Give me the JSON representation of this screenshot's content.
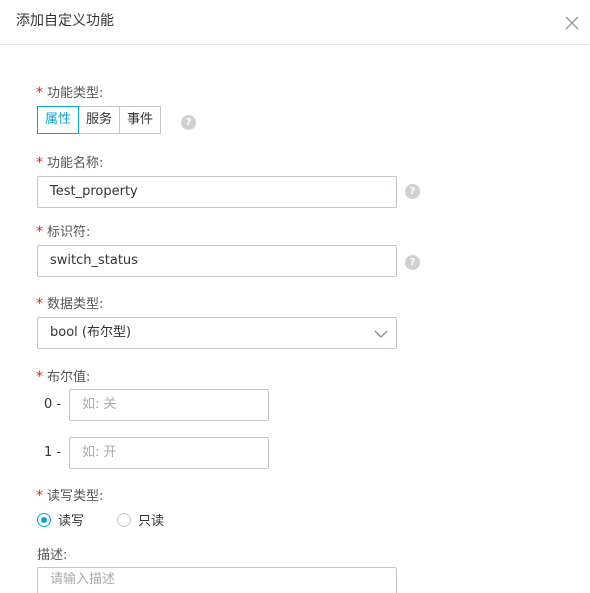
{
  "dialog": {
    "title": "添加自定义功能"
  },
  "fields": {
    "function_type": {
      "label": "功能类型:",
      "options": [
        "属性",
        "服务",
        "事件"
      ],
      "selected": "属性"
    },
    "function_name": {
      "label": "功能名称:",
      "value": "Test_property"
    },
    "identifier": {
      "label": "标识符:",
      "value": "switch_status"
    },
    "data_type": {
      "label": "数据类型:",
      "value": "bool (布尔型)"
    },
    "bool_value": {
      "label": "布尔值:",
      "zero_prefix": "0 -",
      "zero_placeholder": "如: 关",
      "one_prefix": "1 -",
      "one_placeholder": "如: 开"
    },
    "rw_type": {
      "label": "读写类型:",
      "options": [
        "读写",
        "只读"
      ],
      "selected": "读写"
    },
    "description": {
      "label": "描述:",
      "placeholder": "请输入描述"
    }
  },
  "required_mark": "*",
  "help_glyph": "?",
  "colors": {
    "accent": "#0aa3d6",
    "required": "#e2231a",
    "border": "#c4c6cf"
  }
}
